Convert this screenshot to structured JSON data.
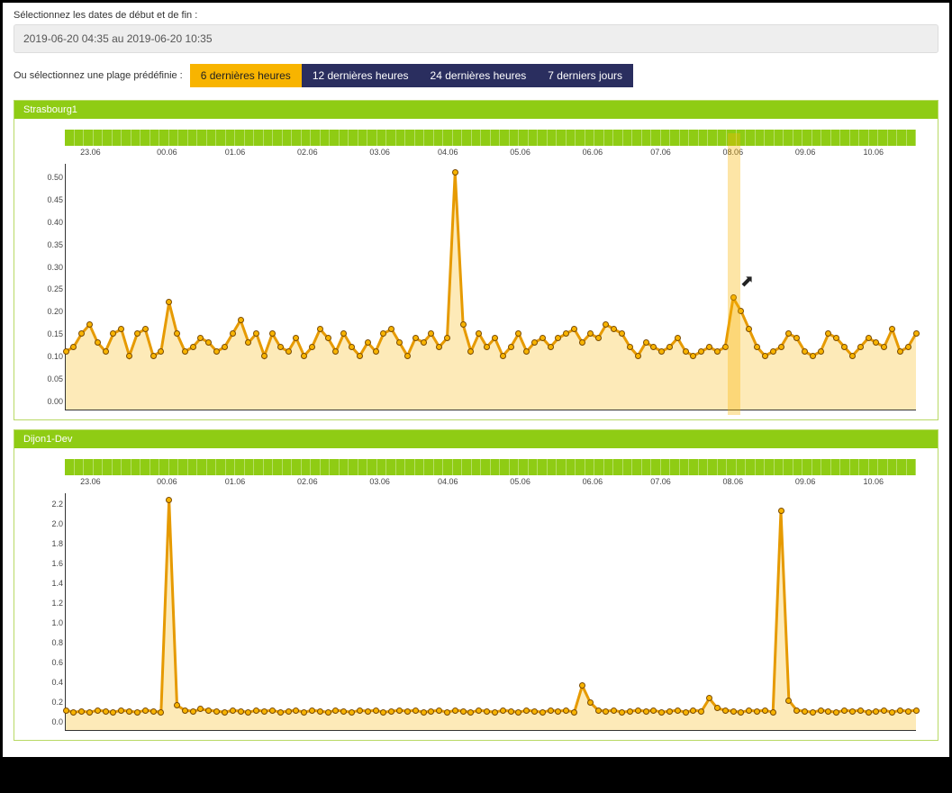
{
  "date_section": {
    "label": "Sélectionnez les dates de début et de fin :",
    "value": "2019-06-20 04:35 au 2019-06-20 10:35"
  },
  "range_section": {
    "label": "Ou sélectionnez une plage prédéfinie :",
    "buttons": [
      {
        "label": "6 dernières heures",
        "active": true
      },
      {
        "label": "12 dernières heures",
        "active": false
      },
      {
        "label": "24 dernières heures",
        "active": false
      },
      {
        "label": "7 derniers jours",
        "active": false
      }
    ]
  },
  "x_ticks": [
    "23.06",
    "00.06",
    "01.06",
    "02.06",
    "03.06",
    "04.06",
    "05.06",
    "06.06",
    "07.06",
    "08.06",
    "09.06",
    "10.06"
  ],
  "highlight_x": "08.06",
  "panels": [
    {
      "title": "Strasbourg1",
      "chart_key": 0
    },
    {
      "title": "Dijon1-Dev",
      "chart_key": 1
    }
  ],
  "chart_data": [
    {
      "type": "area",
      "title": "Strasbourg1",
      "ylim": [
        0.0,
        0.55
      ],
      "y_ticks": [
        0.0,
        0.05,
        0.1,
        0.15,
        0.2,
        0.25,
        0.3,
        0.35,
        0.4,
        0.45,
        0.5
      ],
      "x_ticks": [
        "23.06",
        "00.06",
        "01.06",
        "02.06",
        "03.06",
        "04.06",
        "05.06",
        "06.06",
        "07.06",
        "08.06",
        "09.06",
        "10.06"
      ],
      "values": [
        0.13,
        0.14,
        0.17,
        0.19,
        0.15,
        0.13,
        0.17,
        0.18,
        0.12,
        0.17,
        0.18,
        0.12,
        0.13,
        0.24,
        0.17,
        0.13,
        0.14,
        0.16,
        0.15,
        0.13,
        0.14,
        0.17,
        0.2,
        0.15,
        0.17,
        0.12,
        0.17,
        0.14,
        0.13,
        0.16,
        0.12,
        0.14,
        0.18,
        0.16,
        0.13,
        0.17,
        0.14,
        0.12,
        0.15,
        0.13,
        0.17,
        0.18,
        0.15,
        0.12,
        0.16,
        0.15,
        0.17,
        0.14,
        0.16,
        0.53,
        0.19,
        0.13,
        0.17,
        0.14,
        0.16,
        0.12,
        0.14,
        0.17,
        0.13,
        0.15,
        0.16,
        0.14,
        0.16,
        0.17,
        0.18,
        0.15,
        0.17,
        0.16,
        0.19,
        0.18,
        0.17,
        0.14,
        0.12,
        0.15,
        0.14,
        0.13,
        0.14,
        0.16,
        0.13,
        0.12,
        0.13,
        0.14,
        0.13,
        0.14,
        0.25,
        0.22,
        0.18,
        0.14,
        0.12,
        0.13,
        0.14,
        0.17,
        0.16,
        0.13,
        0.12,
        0.13,
        0.17,
        0.16,
        0.14,
        0.12,
        0.14,
        0.16,
        0.15,
        0.14,
        0.18,
        0.13,
        0.14,
        0.17
      ]
    },
    {
      "type": "area",
      "title": "Dijon1-Dev",
      "ylim": [
        0.0,
        2.4
      ],
      "y_ticks": [
        0.0,
        0.2,
        0.4,
        0.6,
        0.8,
        1.0,
        1.2,
        1.4,
        1.6,
        1.8,
        2.0,
        2.2
      ],
      "x_ticks": [
        "23.06",
        "00.06",
        "01.06",
        "02.06",
        "03.06",
        "04.06",
        "05.06",
        "06.06",
        "07.06",
        "08.06",
        "09.06",
        "10.06"
      ],
      "values": [
        0.2,
        0.18,
        0.19,
        0.18,
        0.2,
        0.19,
        0.18,
        0.2,
        0.19,
        0.18,
        0.2,
        0.19,
        0.18,
        2.33,
        0.25,
        0.2,
        0.19,
        0.21,
        0.2,
        0.19,
        0.18,
        0.2,
        0.19,
        0.18,
        0.2,
        0.19,
        0.2,
        0.18,
        0.19,
        0.2,
        0.18,
        0.2,
        0.19,
        0.18,
        0.2,
        0.19,
        0.18,
        0.2,
        0.19,
        0.2,
        0.18,
        0.19,
        0.2,
        0.19,
        0.2,
        0.18,
        0.19,
        0.2,
        0.18,
        0.2,
        0.19,
        0.18,
        0.2,
        0.19,
        0.18,
        0.2,
        0.19,
        0.18,
        0.2,
        0.19,
        0.18,
        0.2,
        0.19,
        0.2,
        0.18,
        0.45,
        0.28,
        0.2,
        0.19,
        0.2,
        0.18,
        0.19,
        0.2,
        0.19,
        0.2,
        0.18,
        0.19,
        0.2,
        0.18,
        0.2,
        0.19,
        0.32,
        0.22,
        0.2,
        0.19,
        0.18,
        0.2,
        0.19,
        0.2,
        0.18,
        2.22,
        0.3,
        0.2,
        0.19,
        0.18,
        0.2,
        0.19,
        0.18,
        0.2,
        0.19,
        0.2,
        0.18,
        0.19,
        0.2,
        0.18,
        0.2,
        0.19,
        0.2
      ]
    }
  ]
}
